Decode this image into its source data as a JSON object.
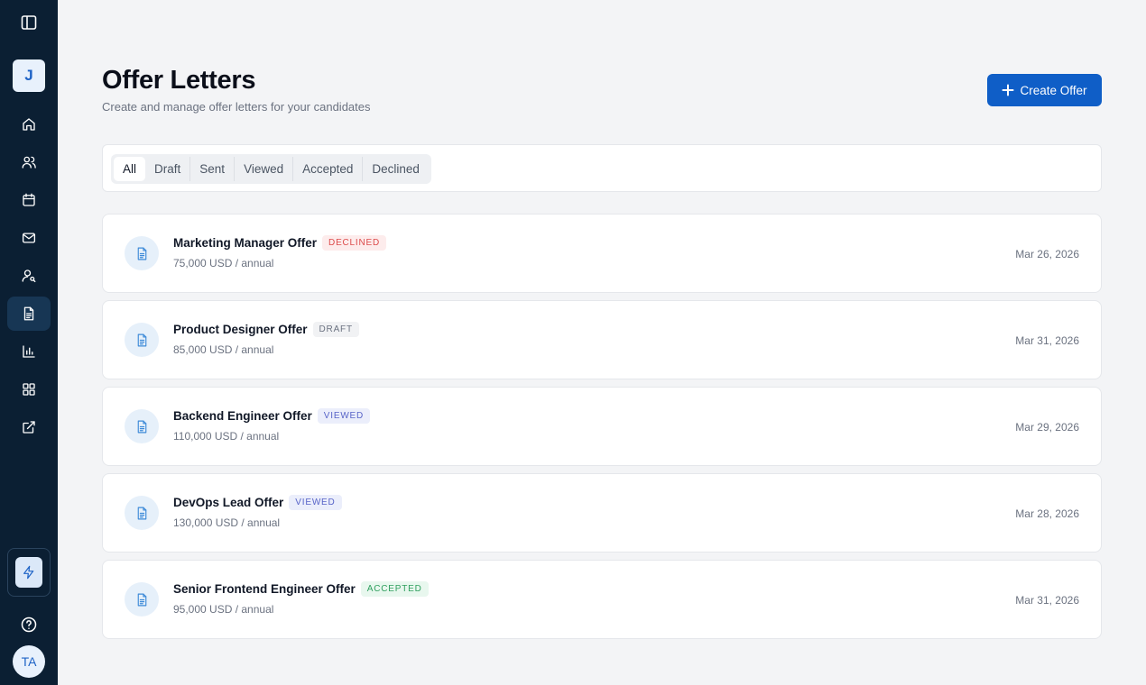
{
  "sidebar": {
    "workspace_initial": "J",
    "avatar_initials": "TA",
    "nav_icons": [
      "home-icon",
      "users-icon",
      "calendar-icon",
      "mail-icon",
      "user-search-icon",
      "document-icon",
      "bar-chart-icon",
      "grid-icon",
      "external-link-icon"
    ],
    "active_item": "document-icon"
  },
  "header": {
    "title": "Offer Letters",
    "subtitle": "Create and manage offer letters for your candidates",
    "create_label": "Create Offer"
  },
  "filters": {
    "tabs": [
      "All",
      "Draft",
      "Sent",
      "Viewed",
      "Accepted",
      "Declined"
    ],
    "active": "All"
  },
  "offers": [
    {
      "title": "Marketing Manager Offer",
      "status": "DECLINED",
      "salary": "75,000 USD / annual",
      "date": "Mar 26, 2026"
    },
    {
      "title": "Product Designer Offer",
      "status": "DRAFT",
      "salary": "85,000 USD / annual",
      "date": "Mar 31, 2026"
    },
    {
      "title": "Backend Engineer Offer",
      "status": "VIEWED",
      "salary": "110,000 USD / annual",
      "date": "Mar 29, 2026"
    },
    {
      "title": "DevOps Lead Offer",
      "status": "VIEWED",
      "salary": "130,000 USD / annual",
      "date": "Mar 28, 2026"
    },
    {
      "title": "Senior Frontend Engineer Offer",
      "status": "ACCEPTED",
      "salary": "95,000 USD / annual",
      "date": "Mar 31, 2026"
    }
  ],
  "colors": {
    "sidebar_bg": "#0b1f33",
    "primary": "#0f5ec7",
    "declined": "#dc4b4b",
    "draft": "#6b7280",
    "viewed": "#5864c8",
    "accepted": "#2f9f5e"
  }
}
